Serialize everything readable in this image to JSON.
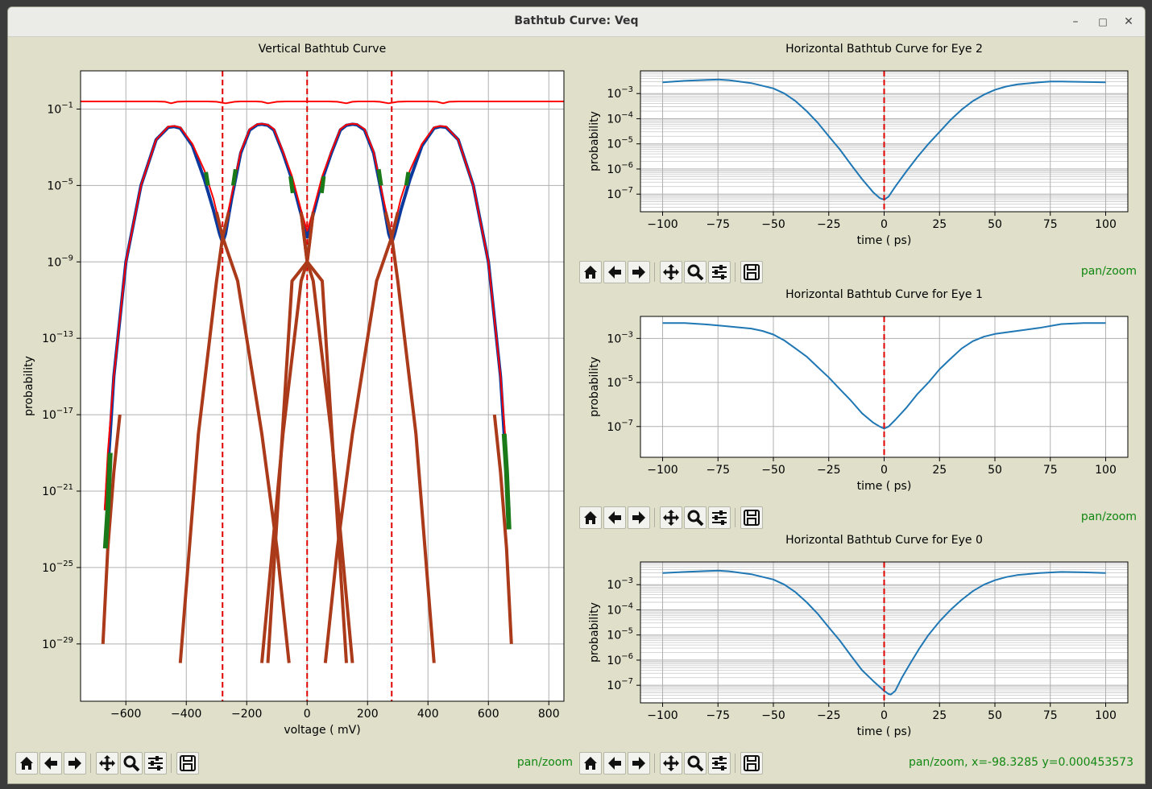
{
  "window": {
    "title": "Bathtub Curve: Veq"
  },
  "toolbar": {
    "mode_label": "pan/zoom",
    "bottom_right_coords": "pan/zoom, x=-98.3285     y=0.000453573"
  },
  "chart_data": [
    {
      "type": "line",
      "title": "Vertical Bathtub Curve",
      "xlabel": "voltage ( mV)",
      "ylabel": "probability",
      "xlim": [
        -750,
        850
      ],
      "ylim": [
        1e-32,
        10
      ],
      "yscale": "log",
      "grid": true,
      "x_ticks": [
        -600,
        -400,
        -200,
        0,
        200,
        400,
        600,
        800
      ],
      "y_ticks": [
        0.1,
        1e-05,
        1e-09,
        1e-13,
        1e-17,
        1e-21,
        1e-25,
        1e-29
      ],
      "eye_boundaries_mV": [
        -280,
        0,
        280
      ],
      "series": [
        {
          "color": "#0b3a9c",
          "width": 4,
          "x": [
            -668,
            -640,
            -600,
            -550,
            -500,
            -460,
            -440,
            -420,
            -380,
            -340,
            -310,
            -290,
            -280,
            -270,
            -250,
            -220,
            -190,
            -165,
            -150,
            -130,
            -110,
            -80,
            -50,
            -20,
            0,
            20,
            50,
            80,
            110,
            130,
            150,
            165,
            190,
            220,
            250,
            270,
            280,
            290,
            310,
            340,
            380,
            420,
            440,
            460,
            500,
            550,
            600,
            640,
            668
          ],
          "y": [
            1e-22,
            1e-15,
            1e-09,
            1e-05,
            0.0025,
            0.011,
            0.012,
            0.01,
            0.0012,
            2e-05,
            5e-07,
            3e-08,
            1e-08,
            3e-08,
            2e-06,
            0.0005,
            0.008,
            0.015,
            0.016,
            0.014,
            0.008,
            0.0005,
            2e-05,
            3e-07,
            2e-08,
            3e-07,
            2e-05,
            0.0005,
            0.008,
            0.014,
            0.016,
            0.015,
            0.008,
            0.0005,
            2e-06,
            3e-08,
            1e-08,
            3e-08,
            5e-07,
            2e-05,
            0.0012,
            0.01,
            0.012,
            0.011,
            0.0025,
            1e-05,
            1e-09,
            1e-15,
            1e-22
          ]
        },
        {
          "color": "#ff0000",
          "width": 2,
          "x": [
            -670,
            -660,
            -640,
            -600,
            -550,
            -500,
            -460,
            -440,
            -420,
            -380,
            -340,
            -310,
            -280
          ],
          "y": [
            1e-22,
            1e-19,
            1e-15,
            1e-09,
            1e-05,
            0.0025,
            0.012,
            0.013,
            0.011,
            0.0015,
            6e-05,
            2e-06,
            2e-08
          ]
        },
        {
          "color": "#ff0000",
          "width": 2,
          "x": [
            -280,
            -250,
            -220,
            -190,
            -165,
            -150,
            -130,
            -110,
            -80,
            -50,
            -20,
            0
          ],
          "y": [
            2e-08,
            3e-06,
            0.0006,
            0.009,
            0.016,
            0.017,
            0.015,
            0.009,
            0.0006,
            3e-05,
            5e-07,
            4e-08
          ]
        },
        {
          "color": "#ff0000",
          "width": 2,
          "x": [
            0,
            20,
            50,
            80,
            110,
            130,
            150,
            165,
            190,
            220,
            250,
            280
          ],
          "y": [
            4e-08,
            5e-07,
            3e-05,
            0.0006,
            0.009,
            0.015,
            0.017,
            0.016,
            0.009,
            0.0006,
            3e-06,
            2e-08
          ]
        },
        {
          "color": "#ff0000",
          "width": 2,
          "x": [
            280,
            310,
            340,
            380,
            420,
            440,
            460,
            500,
            550,
            600,
            640,
            660,
            670
          ],
          "y": [
            2e-08,
            2e-06,
            6e-05,
            0.0015,
            0.011,
            0.013,
            0.012,
            0.0025,
            1e-05,
            1e-09,
            1e-15,
            1e-19,
            1e-22
          ]
        },
        {
          "color": "#ff0000",
          "width": 2,
          "x": [
            -750,
            -600,
            -500,
            -470,
            -450,
            -430,
            -400,
            -330,
            -300,
            -270,
            -240,
            -220,
            -200,
            -170,
            -150,
            -130,
            -100,
            -70,
            -40,
            -20,
            20,
            40,
            70,
            100,
            130,
            150,
            170,
            200,
            220,
            240,
            270,
            300,
            330,
            400,
            430,
            450,
            470,
            500,
            600,
            850
          ],
          "y": [
            0.25,
            0.25,
            0.25,
            0.24,
            0.2,
            0.24,
            0.25,
            0.25,
            0.24,
            0.2,
            0.24,
            0.25,
            0.25,
            0.25,
            0.24,
            0.2,
            0.24,
            0.25,
            0.25,
            0.25,
            0.25,
            0.25,
            0.25,
            0.24,
            0.2,
            0.24,
            0.25,
            0.25,
            0.25,
            0.24,
            0.2,
            0.24,
            0.25,
            0.25,
            0.24,
            0.2,
            0.24,
            0.25,
            0.25,
            0.25
          ]
        },
        {
          "color": "#aa3a1a",
          "width": 4,
          "x": [
            -676,
            -660,
            -640,
            -620
          ],
          "y": [
            1e-29,
            1e-24,
            1e-20,
            1e-17
          ]
        },
        {
          "color": "#aa3a1a",
          "width": 4,
          "x": [
            676,
            660,
            640,
            620
          ],
          "y": [
            1e-29,
            1e-24,
            1e-20,
            1e-17
          ]
        },
        {
          "color": "#aa3a1a",
          "width": 4,
          "x": [
            -420,
            -360,
            -300,
            -280,
            -260
          ],
          "y": [
            1e-30,
            1e-18,
            1e-10,
            2e-08,
            4e-07
          ]
        },
        {
          "color": "#aa3a1a",
          "width": 4,
          "x": [
            -300,
            -280,
            -230,
            -150,
            -100,
            -60
          ],
          "y": [
            4e-07,
            2e-08,
            1e-10,
            1e-18,
            1e-24,
            1e-30
          ]
        },
        {
          "color": "#aa3a1a",
          "width": 4,
          "x": [
            -150,
            -80,
            -20,
            0,
            20
          ],
          "y": [
            1e-30,
            1e-18,
            1e-10,
            1e-09,
            4e-07
          ]
        },
        {
          "color": "#aa3a1a",
          "width": 4,
          "x": [
            -20,
            0,
            50,
            130
          ],
          "y": [
            4e-07,
            1e-09,
            1e-10,
            1e-30
          ]
        },
        {
          "color": "#aa3a1a",
          "width": 4,
          "x": [
            -130,
            -50,
            0,
            20
          ],
          "y": [
            1e-30,
            1e-10,
            1e-09,
            4e-07
          ]
        },
        {
          "color": "#aa3a1a",
          "width": 4,
          "x": [
            -20,
            0,
            20,
            80,
            150
          ],
          "y": [
            4e-07,
            1e-09,
            1e-10,
            1e-18,
            1e-30
          ]
        },
        {
          "color": "#aa3a1a",
          "width": 4,
          "x": [
            60,
            100,
            150,
            230,
            280,
            300
          ],
          "y": [
            1e-30,
            1e-24,
            1e-18,
            1e-10,
            2e-08,
            4e-07
          ]
        },
        {
          "color": "#aa3a1a",
          "width": 4,
          "x": [
            260,
            280,
            300,
            360,
            420
          ],
          "y": [
            4e-07,
            2e-08,
            1e-10,
            1e-18,
            1e-30
          ]
        },
        {
          "color": "#1a7a1a",
          "width": 6,
          "x": [
            -668,
            -660,
            -652
          ],
          "y": [
            1e-24,
            1e-22,
            1e-19
          ]
        },
        {
          "color": "#1a7a1a",
          "width": 6,
          "x": [
            652,
            660,
            668
          ],
          "y": [
            1e-18,
            1e-20,
            1e-23
          ]
        },
        {
          "color": "#1a7a1a",
          "width": 5,
          "x": [
            -335,
            -328
          ],
          "y": [
            5e-05,
            1e-05
          ]
        },
        {
          "color": "#1a7a1a",
          "width": 5,
          "x": [
            -245,
            -237
          ],
          "y": [
            1e-05,
            7e-05
          ]
        },
        {
          "color": "#1a7a1a",
          "width": 5,
          "x": [
            -55,
            -48
          ],
          "y": [
            3e-05,
            4e-06
          ]
        },
        {
          "color": "#1a7a1a",
          "width": 5,
          "x": [
            48,
            55
          ],
          "y": [
            4e-06,
            3e-05
          ]
        },
        {
          "color": "#1a7a1a",
          "width": 5,
          "x": [
            237,
            245
          ],
          "y": [
            7e-05,
            1e-05
          ]
        },
        {
          "color": "#1a7a1a",
          "width": 5,
          "x": [
            328,
            335
          ],
          "y": [
            1e-05,
            5e-05
          ]
        }
      ]
    },
    {
      "type": "line",
      "title": "Horizontal Bathtub Curve for Eye 2",
      "xlabel": "time ( ps)",
      "ylabel": "probability",
      "xlim": [
        -110,
        110
      ],
      "ylim": [
        2e-08,
        0.008
      ],
      "yscale": "log",
      "grid": true,
      "minor_grid": true,
      "x_ticks": [
        -100,
        -75,
        -50,
        -25,
        0,
        25,
        50,
        75,
        100
      ],
      "y_ticks": [
        0.001,
        0.0001,
        1e-05,
        1e-06,
        1e-07
      ],
      "series": [
        {
          "color": "#1f77b4",
          "x": [
            -100,
            -90,
            -80,
            -75,
            -70,
            -60,
            -50,
            -45,
            -40,
            -35,
            -30,
            -25,
            -20,
            -15,
            -10,
            -5,
            -2,
            0,
            2,
            5,
            10,
            15,
            20,
            25,
            30,
            35,
            40,
            45,
            50,
            55,
            60,
            70,
            75,
            80,
            90,
            100
          ],
          "y": [
            0.0028,
            0.0032,
            0.0035,
            0.0036,
            0.0034,
            0.0026,
            0.0016,
            0.001,
            0.0005,
            0.0002,
            7e-05,
            2e-05,
            6e-06,
            1.5e-06,
            4e-07,
            1.2e-07,
            7e-08,
            6e-08,
            8e-08,
            2e-07,
            8e-07,
            3e-06,
            1e-05,
            3e-05,
            9e-05,
            0.00023,
            0.0005,
            0.0009,
            0.0014,
            0.0019,
            0.0023,
            0.0028,
            0.003,
            0.003,
            0.0029,
            0.0028
          ]
        }
      ]
    },
    {
      "type": "line",
      "title": "Horizontal Bathtub Curve for Eye 1",
      "xlabel": "time ( ps)",
      "ylabel": "probability",
      "xlim": [
        -110,
        110
      ],
      "ylim": [
        4e-09,
        0.01
      ],
      "yscale": "log",
      "grid": true,
      "x_ticks": [
        -100,
        -75,
        -50,
        -25,
        0,
        25,
        50,
        75,
        100
      ],
      "y_ticks": [
        0.001,
        1e-05,
        1e-07
      ],
      "series": [
        {
          "color": "#1f77b4",
          "x": [
            -100,
            -90,
            -80,
            -70,
            -60,
            -55,
            -50,
            -45,
            -40,
            -35,
            -30,
            -25,
            -20,
            -15,
            -10,
            -5,
            -2,
            0,
            2,
            5,
            10,
            15,
            20,
            25,
            30,
            35,
            40,
            45,
            50,
            60,
            70,
            80,
            90,
            100
          ],
          "y": [
            0.005,
            0.005,
            0.0043,
            0.0035,
            0.0028,
            0.0022,
            0.0015,
            0.0008,
            0.00035,
            0.00015,
            5e-05,
            1.7e-05,
            5e-06,
            1.5e-06,
            4e-07,
            1.5e-07,
            1e-07,
            8e-08,
            1e-07,
            2e-07,
            7e-07,
            3e-06,
            1e-05,
            4e-05,
            0.00012,
            0.00035,
            0.00075,
            0.0012,
            0.0016,
            0.0022,
            0.003,
            0.0045,
            0.005,
            0.005
          ]
        }
      ]
    },
    {
      "type": "line",
      "title": "Horizontal Bathtub Curve for Eye 0",
      "xlabel": "time ( ps)",
      "ylabel": "probability",
      "xlim": [
        -110,
        110
      ],
      "ylim": [
        2e-08,
        0.008
      ],
      "yscale": "log",
      "grid": true,
      "minor_grid": true,
      "x_ticks": [
        -100,
        -75,
        -50,
        -25,
        0,
        25,
        50,
        75,
        100
      ],
      "y_ticks": [
        0.001,
        0.0001,
        1e-05,
        1e-06,
        1e-07
      ],
      "series": [
        {
          "color": "#1f77b4",
          "x": [
            -100,
            -90,
            -80,
            -75,
            -70,
            -60,
            -50,
            -45,
            -40,
            -35,
            -30,
            -25,
            -20,
            -15,
            -10,
            -5,
            0,
            2,
            3,
            5,
            8,
            12,
            16,
            20,
            25,
            30,
            35,
            40,
            45,
            50,
            55,
            60,
            70,
            80,
            90,
            100
          ],
          "y": [
            0.0029,
            0.0032,
            0.0035,
            0.0036,
            0.0034,
            0.0026,
            0.0016,
            0.001,
            0.0005,
            0.0002,
            7e-05,
            2e-05,
            6e-06,
            1.5e-06,
            4e-07,
            1.5e-07,
            6e-08,
            4.5e-08,
            4.3e-08,
            6e-08,
            2e-07,
            8e-07,
            3e-06,
            1e-05,
            3.5e-05,
            0.0001,
            0.00025,
            0.00055,
            0.001,
            0.0015,
            0.002,
            0.0024,
            0.0029,
            0.0032,
            0.0031,
            0.0029
          ]
        }
      ]
    }
  ]
}
